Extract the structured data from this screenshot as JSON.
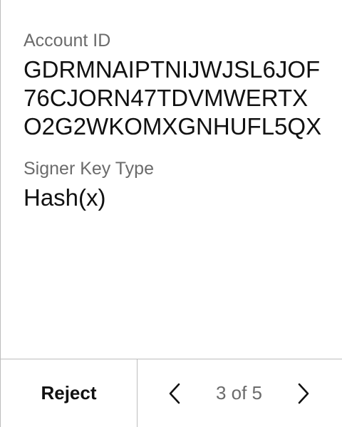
{
  "account": {
    "label": "Account ID",
    "value": "GDRMNAIPTNIJWJSL6JOF76CJORN47TDVMWERTXO2G2WKOMXGNHUFL5QX"
  },
  "signer": {
    "label": "Signer Key Type",
    "value": "Hash(x)"
  },
  "footer": {
    "reject_label": "Reject",
    "pager_text": "3 of 5",
    "prev_icon": "chevron-left",
    "next_icon": "chevron-right"
  },
  "colors": {
    "text": "#111111",
    "label": "#6b6b6b",
    "divider": "#bdbdbd",
    "background": "#ffffff"
  }
}
